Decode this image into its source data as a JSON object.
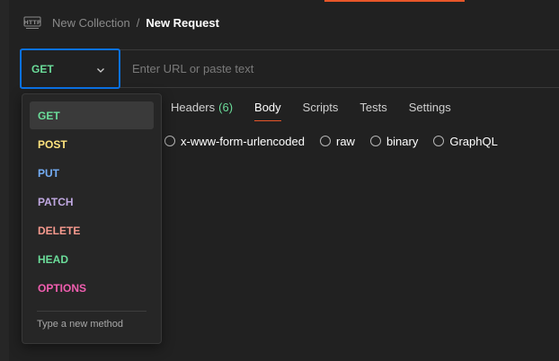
{
  "header": {
    "icon": "http-icon",
    "parent": "New Collection",
    "separator": "/",
    "current": "New Request"
  },
  "request": {
    "method": "GET",
    "url_value": "",
    "url_placeholder": "Enter URL or paste text"
  },
  "tabs": [
    {
      "label": "Headers",
      "count": "(6)",
      "active": false
    },
    {
      "label": "Body",
      "count": "",
      "active": true
    },
    {
      "label": "Scripts",
      "count": "",
      "active": false
    },
    {
      "label": "Tests",
      "count": "",
      "active": false
    },
    {
      "label": "Settings",
      "count": "",
      "active": false
    }
  ],
  "body_types": [
    {
      "label": "x-www-form-urlencoded",
      "selected": false
    },
    {
      "label": "raw",
      "selected": false
    },
    {
      "label": "binary",
      "selected": false
    },
    {
      "label": "GraphQL",
      "selected": false
    }
  ],
  "method_menu": {
    "items": [
      {
        "label": "GET",
        "color": "#6bdd9a",
        "selected": true
      },
      {
        "label": "POST",
        "color": "#ffe47e",
        "selected": false
      },
      {
        "label": "PUT",
        "color": "#74aef6",
        "selected": false
      },
      {
        "label": "PATCH",
        "color": "#c0a8e1",
        "selected": false
      },
      {
        "label": "DELETE",
        "color": "#f79a8e",
        "selected": false
      },
      {
        "label": "HEAD",
        "color": "#6bdd9a",
        "selected": false
      },
      {
        "label": "OPTIONS",
        "color": "#f15eb0",
        "selected": false
      }
    ],
    "footer": "Type a new method"
  },
  "colors": {
    "background": "#212121",
    "accent": "#e8562a",
    "focus_border": "#0b72e7",
    "get_green": "#6bdd9a"
  }
}
